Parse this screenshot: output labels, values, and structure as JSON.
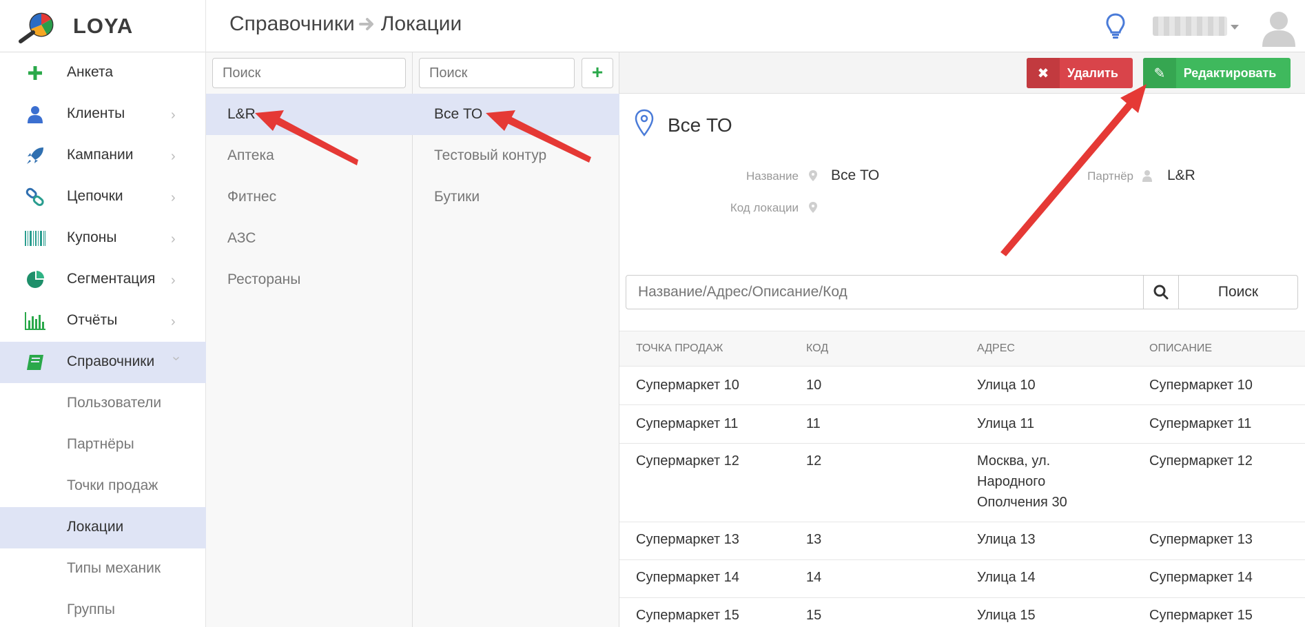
{
  "app": {
    "name": "LOYA"
  },
  "breadcrumb": {
    "parent": "Справочники",
    "current": "Локации"
  },
  "sidebar": {
    "items": [
      {
        "label": "Анкета",
        "icon": "plus-icon",
        "has_chevron": false
      },
      {
        "label": "Клиенты",
        "icon": "user-icon",
        "has_chevron": true
      },
      {
        "label": "Кампании",
        "icon": "rocket-icon",
        "has_chevron": true
      },
      {
        "label": "Цепочки",
        "icon": "chain-icon",
        "has_chevron": true
      },
      {
        "label": "Купоны",
        "icon": "barcode-icon",
        "has_chevron": true
      },
      {
        "label": "Сегментация",
        "icon": "pie-icon",
        "has_chevron": true
      },
      {
        "label": "Отчёты",
        "icon": "bar-chart-icon",
        "has_chevron": true
      },
      {
        "label": "Справочники",
        "icon": "book-icon",
        "has_chevron": true,
        "expanded": true
      }
    ],
    "subitems": [
      {
        "label": "Пользователи"
      },
      {
        "label": "Партнёры"
      },
      {
        "label": "Точки продаж"
      },
      {
        "label": "Локации",
        "active": true
      },
      {
        "label": "Типы механик"
      },
      {
        "label": "Группы"
      }
    ]
  },
  "partners": {
    "search_placeholder": "Поиск",
    "items": [
      "L&R",
      "Аптека",
      "Фитнес",
      "АЗС",
      "Рестораны"
    ],
    "selected_index": 0
  },
  "locations": {
    "search_placeholder": "Поиск",
    "add_label": "+",
    "items": [
      "Все ТО",
      "Тестовый контур",
      "Бутики"
    ],
    "selected_index": 0
  },
  "toolbar": {
    "delete_label": "Удалить",
    "edit_label": "Редактировать"
  },
  "detail": {
    "title": "Все ТО",
    "name_label": "Название",
    "name_value": "Все ТО",
    "code_label": "Код локации",
    "code_value": "",
    "partner_label": "Партнёр",
    "partner_value": "L&R"
  },
  "pos_search": {
    "placeholder": "Название/Адрес/Описание/Код",
    "button_label": "Поиск"
  },
  "table": {
    "headers": [
      "Точка продаж",
      "Код",
      "Адрес",
      "Описание"
    ],
    "rows": [
      [
        "Супермаркет 10",
        "10",
        "Улица 10",
        "Супермаркет 10"
      ],
      [
        "Супермаркет 11",
        "11",
        "Улица 11",
        "Супермаркет 11"
      ],
      [
        "Супермаркет 12",
        "12",
        "Москва, ул. Народного Ополчения 30",
        "Супермаркет 12"
      ],
      [
        "Супермаркет 13",
        "13",
        "Улица 13",
        "Супермаркет 13"
      ],
      [
        "Супермаркет 14",
        "14",
        "Улица 14",
        "Супермаркет 14"
      ],
      [
        "Супермаркет 15",
        "15",
        "Улица 15",
        "Супермаркет 15"
      ]
    ]
  },
  "colors": {
    "accent_green": "#3fb95d",
    "danger_red": "#d9444a",
    "active_row": "#dfe4f5",
    "annotation_arrow": "#e53935"
  }
}
